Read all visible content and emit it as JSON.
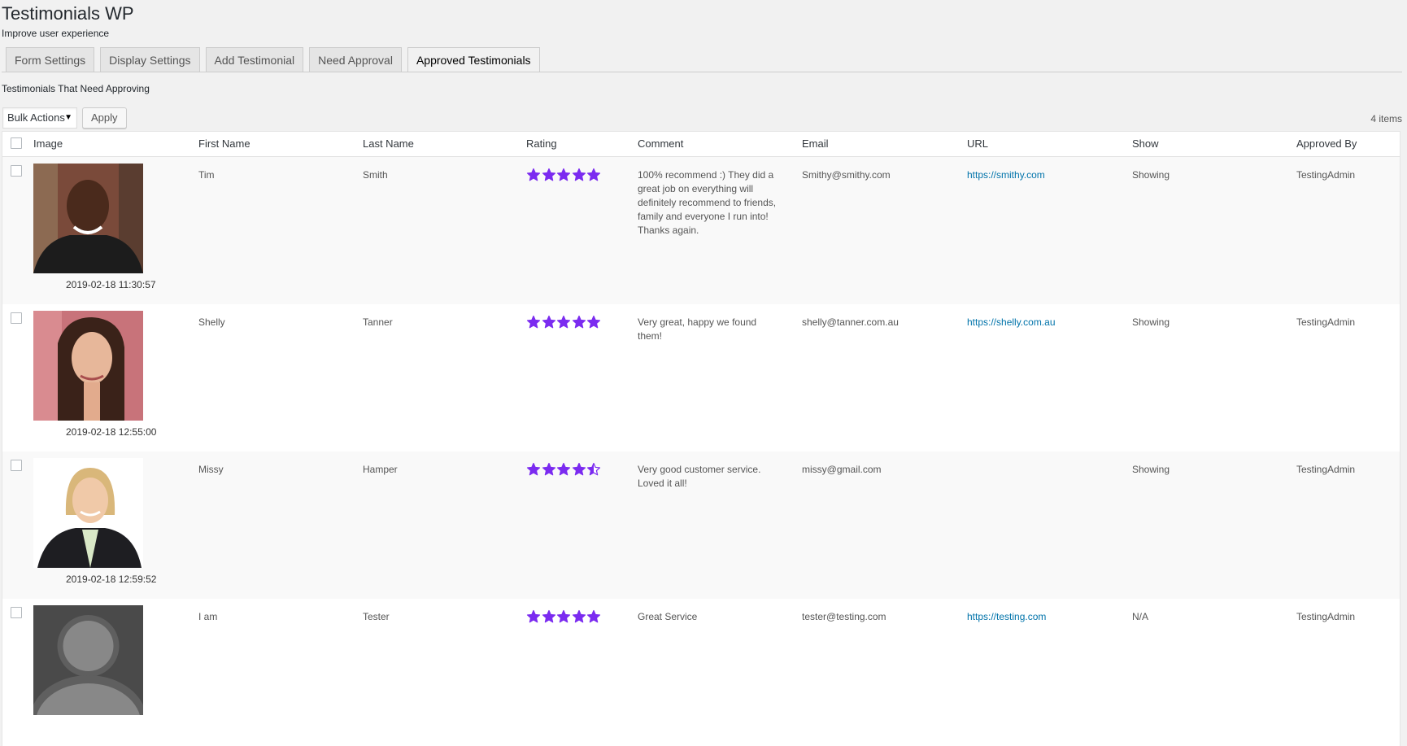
{
  "header": {
    "title": "Testimonials WP",
    "subtitle": "Improve user experience"
  },
  "tabs": [
    {
      "label": "Form Settings"
    },
    {
      "label": "Display Settings"
    },
    {
      "label": "Add Testimonial"
    },
    {
      "label": "Need Approval"
    },
    {
      "label": "Approved Testimonials"
    }
  ],
  "active_tab": "Approved Testimonials",
  "section_label": "Testimonials That Need Approving",
  "bulk": {
    "select_value": "Bulk Actions",
    "apply_label": "Apply"
  },
  "items_count": "4 items",
  "columns": {
    "image": "Image",
    "first_name": "First Name",
    "last_name": "Last Name",
    "rating": "Rating",
    "comment": "Comment",
    "email": "Email",
    "url": "URL",
    "show": "Show",
    "approved_by": "Approved By"
  },
  "star_color": "#7b2bf0",
  "rows": [
    {
      "first_name": "Tim",
      "last_name": "Smith",
      "rating": 5,
      "comment": "100% recommend :) They did a great job on everything will definitely recommend to friends, family and everyone I run into! Thanks again.",
      "email": "Smithy@smithy.com",
      "url": "https://smithy.com",
      "show": "Showing",
      "approved_by": "TestingAdmin",
      "date": "2019-02-18 11:30:57"
    },
    {
      "first_name": "Shelly",
      "last_name": "Tanner",
      "rating": 5,
      "comment": "Very great, happy we found them!",
      "email": "shelly@tanner.com.au",
      "url": "https://shelly.com.au",
      "show": "Showing",
      "approved_by": "TestingAdmin",
      "date": "2019-02-18 12:55:00"
    },
    {
      "first_name": "Missy",
      "last_name": "Hamper",
      "rating": 4.5,
      "comment": "Very good customer service. Loved it all!",
      "email": "missy@gmail.com",
      "url": "",
      "show": "Showing",
      "approved_by": "TestingAdmin",
      "date": "2019-02-18 12:59:52"
    },
    {
      "first_name": "I am",
      "last_name": "Tester",
      "rating": 5,
      "comment": "Great Service",
      "email": "tester@testing.com",
      "url": "https://testing.com",
      "show": "N/A",
      "approved_by": "TestingAdmin",
      "date": ""
    }
  ]
}
